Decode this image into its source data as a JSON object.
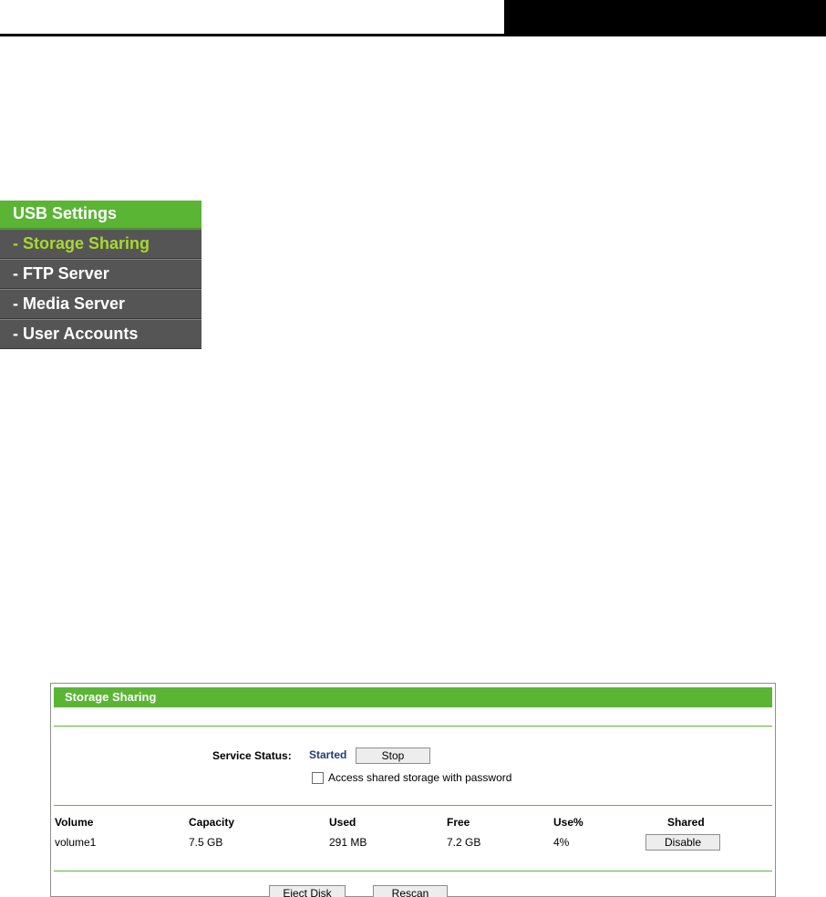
{
  "usb_menu": {
    "header": "USB Settings",
    "items": [
      {
        "label": "- Storage Sharing",
        "active": true
      },
      {
        "label": "- FTP Server",
        "active": false
      },
      {
        "label": "- Media Server",
        "active": false
      },
      {
        "label": "- User Accounts",
        "active": false
      }
    ]
  },
  "storage_sharing": {
    "title": "Storage Sharing",
    "service_status_label": "Service Status:",
    "service_status_value": "Started",
    "stop_button": "Stop",
    "password_checkbox_label": "Access shared storage with password",
    "password_checkbox_checked": false,
    "table": {
      "headers": [
        "Volume",
        "Capacity",
        "Used",
        "Free",
        "Use%",
        "Shared"
      ],
      "rows": [
        {
          "volume": "volume1",
          "capacity": "7.5 GB",
          "used": "291 MB",
          "free": "7.2 GB",
          "use_percent": "4%",
          "shared_button": "Disable"
        }
      ]
    },
    "eject_button": "Eject Disk",
    "rescan_button": "Rescan"
  },
  "colors": {
    "accent_green": "#5ab535",
    "menu_bg": "#555555",
    "menu_active_text": "#a8d830",
    "status_text": "#1f3d7a"
  }
}
